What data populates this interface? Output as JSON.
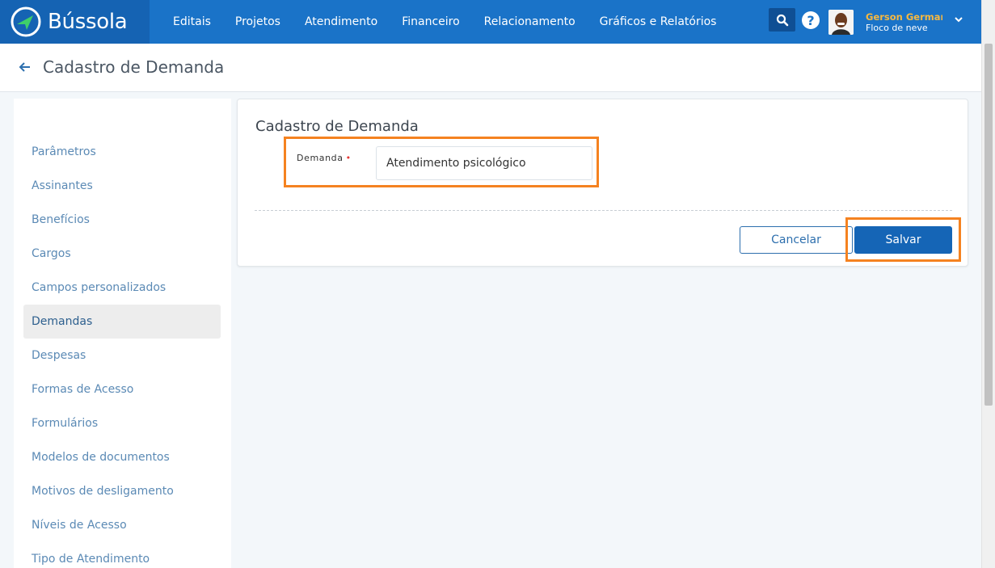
{
  "brand": {
    "name": "Bússola",
    "color": "#1563b3"
  },
  "nav": {
    "items": [
      "Editais",
      "Projetos",
      "Atendimento",
      "Financeiro",
      "Relacionamento",
      "Gráficos e Relatórios"
    ]
  },
  "header_icons": {
    "search": "search-icon",
    "help": "help-icon",
    "help_glyph": "?"
  },
  "user": {
    "name": "Gerson German",
    "subtitle": "Floco de neve"
  },
  "page": {
    "title": "Cadastro de Demanda"
  },
  "sidebar": {
    "items": [
      {
        "label": "Parâmetros",
        "active": false
      },
      {
        "label": "Assinantes",
        "active": false
      },
      {
        "label": "Benefícios",
        "active": false
      },
      {
        "label": "Cargos",
        "active": false
      },
      {
        "label": "Campos personalizados",
        "active": false
      },
      {
        "label": "Demandas",
        "active": true
      },
      {
        "label": "Despesas",
        "active": false
      },
      {
        "label": "Formas de Acesso",
        "active": false
      },
      {
        "label": "Formulários",
        "active": false
      },
      {
        "label": "Modelos de documentos",
        "active": false
      },
      {
        "label": "Motivos de desligamento",
        "active": false
      },
      {
        "label": "Níveis de Acesso",
        "active": false
      },
      {
        "label": "Tipo de Atendimento",
        "active": false
      }
    ]
  },
  "form": {
    "title": "Cadastro de Demanda",
    "field_label": "Demanda",
    "required_mark": "•",
    "field_value": "Atendimento psicológico",
    "cancel_label": "Cancelar",
    "save_label": "Salvar"
  },
  "colors": {
    "topbar": "#1a73c8",
    "accent": "#1565b6",
    "highlight": "#f58220",
    "user_name": "#f5b841"
  }
}
